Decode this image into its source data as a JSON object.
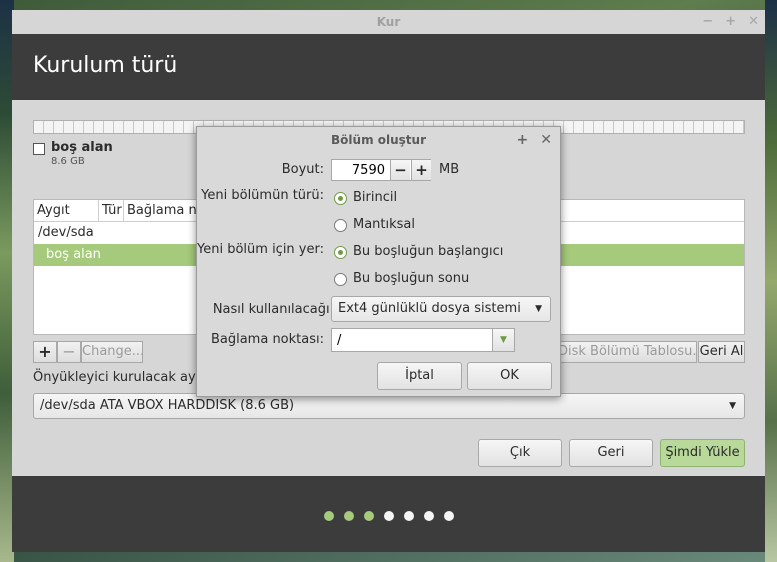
{
  "window": {
    "title": "Kur",
    "controls": [
      "−",
      "+",
      "✕"
    ]
  },
  "header": {
    "title": "Kurulum türü"
  },
  "disk_legend": {
    "name": "boş alan",
    "size": "8.6 GB"
  },
  "table": {
    "columns": [
      "Aygıt",
      "Tür",
      "Bağlama no"
    ],
    "rows": [
      "/dev/sda",
      "boş alan"
    ]
  },
  "toolbar": {
    "add": "+",
    "remove": "−",
    "change": "Change...",
    "new_table": "Disk Bölümü Tablosu...",
    "revert": "Geri Al"
  },
  "bootloader": {
    "label": "Önyükleyici kurulacak aygı",
    "value": "/dev/sda   ATA VBOX HARDDISK (8.6 GB)"
  },
  "buttons": {
    "quit": "Çık",
    "back": "Geri",
    "install": "Şimdi Yükle"
  },
  "progress": {
    "total": 7,
    "completed": 3
  },
  "dialog": {
    "title": "Bölüm oluştur",
    "controls": [
      "+",
      "✕"
    ],
    "size_label": "Boyut:",
    "size_value": "7590",
    "size_unit": "MB",
    "type_label": "Yeni bölümün türü:",
    "type_primary": "Birincil",
    "type_logical": "Mantıksal",
    "location_label": "Yeni bölüm için yer:",
    "location_start": "Bu boşluğun başlangıcı",
    "location_end": "Bu boşluğun sonu",
    "use_label": "Nasıl kullanılacağı:",
    "use_value": "Ext4 günlüklü dosya sistemi",
    "mount_label": "Bağlama noktası:",
    "mount_value": "/",
    "cancel": "İptal",
    "ok": "OK"
  },
  "colors": {
    "accent": "#a5ca7b",
    "header_bg": "#3c3c3c",
    "window_bg": "#d6d6d6"
  }
}
